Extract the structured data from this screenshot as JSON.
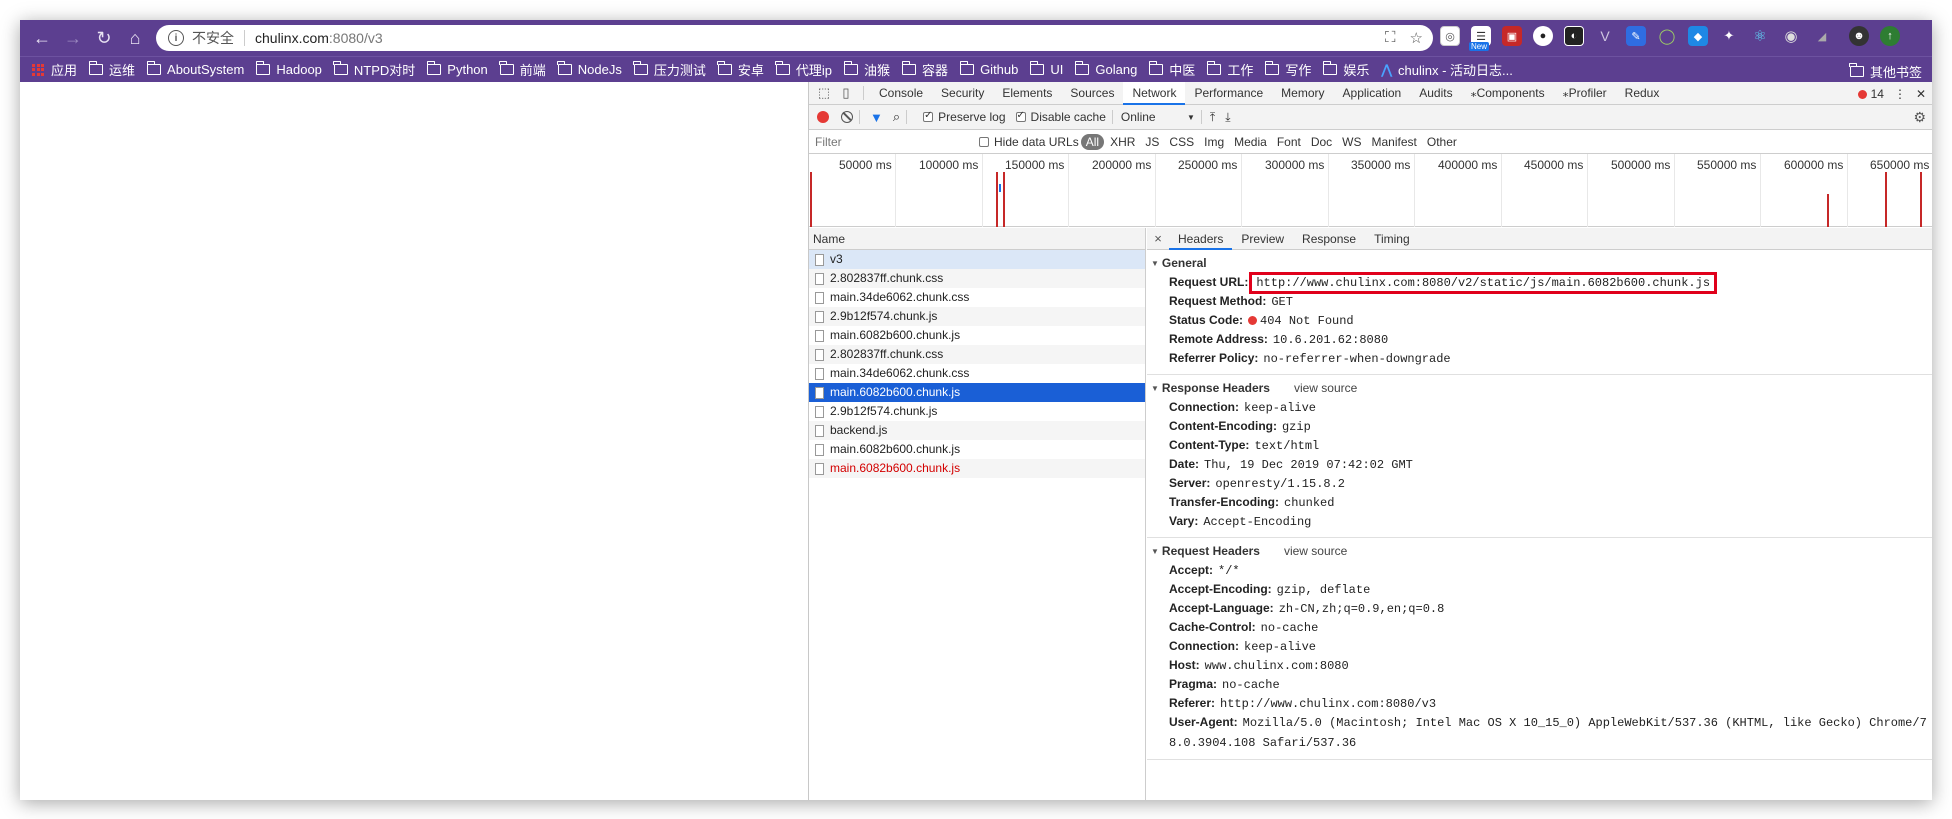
{
  "browser": {
    "nav": {
      "back": "←",
      "forward": "→",
      "reload": "↻",
      "home": "⌂"
    },
    "omnibox": {
      "security": "不安全",
      "url_host": "chulinx.com",
      "url_rest": ":8080/v3"
    },
    "ext_badge": "New"
  },
  "bookmarks": {
    "apps": "应用",
    "items": [
      "运维",
      "AboutSystem",
      "Hadoop",
      "NTPD对时",
      "Python",
      "前端",
      "NodeJs",
      "压力测试",
      "安卓",
      "代理ip",
      "油猴",
      "容器",
      "Github",
      "UI",
      "Golang",
      "中医",
      "工作",
      "写作",
      "娱乐"
    ],
    "special": "chulinx - 活动日志...",
    "other": "其他书签"
  },
  "devtools": {
    "tabs": [
      "Console",
      "Security",
      "Elements",
      "Sources",
      "Network",
      "Performance",
      "Memory",
      "Application",
      "Audits",
      "⁎Components",
      "⁎Profiler",
      "Redux"
    ],
    "active_tab": "Network",
    "error_count": "14",
    "toolbar": {
      "preserve_log": "Preserve log",
      "disable_cache": "Disable cache",
      "throttle": "Online"
    },
    "filter": {
      "placeholder": "Filter",
      "hide_data_urls": "Hide data URLs",
      "types": [
        "All",
        "XHR",
        "JS",
        "CSS",
        "Img",
        "Media",
        "Font",
        "Doc",
        "WS",
        "Manifest",
        "Other"
      ]
    },
    "overview_ticks": [
      "50000 ms",
      "100000 ms",
      "150000 ms",
      "200000 ms",
      "250000 ms",
      "300000 ms",
      "350000 ms",
      "400000 ms",
      "450000 ms",
      "500000 ms",
      "550000 ms",
      "600000 ms",
      "650000 ms"
    ],
    "name_header": "Name",
    "requests": [
      "v3",
      "2.802837ff.chunk.css",
      "main.34de6062.chunk.css",
      "2.9b12f574.chunk.js",
      "main.6082b600.chunk.js",
      "2.802837ff.chunk.css",
      "main.34de6062.chunk.css",
      "main.6082b600.chunk.js",
      "2.9b12f574.chunk.js",
      "backend.js",
      "main.6082b600.chunk.js",
      "main.6082b600.chunk.js"
    ],
    "detail_tabs": [
      "Headers",
      "Preview",
      "Response",
      "Timing"
    ],
    "general": {
      "title": "General",
      "request_url_k": "Request URL:",
      "request_url_v": "http://www.chulinx.com:8080/v2/static/js/main.6082b600.chunk.js",
      "method_k": "Request Method:",
      "method_v": "GET",
      "status_k": "Status Code:",
      "status_v": "404 Not Found",
      "remote_k": "Remote Address:",
      "remote_v": "10.6.201.62:8080",
      "referrer_k": "Referrer Policy:",
      "referrer_v": "no-referrer-when-downgrade"
    },
    "response_headers": {
      "title": "Response Headers",
      "view_source": "view source",
      "rows": [
        {
          "k": "Connection:",
          "v": "keep-alive"
        },
        {
          "k": "Content-Encoding:",
          "v": "gzip"
        },
        {
          "k": "Content-Type:",
          "v": "text/html"
        },
        {
          "k": "Date:",
          "v": "Thu, 19 Dec 2019 07:42:02 GMT"
        },
        {
          "k": "Server:",
          "v": "openresty/1.15.8.2"
        },
        {
          "k": "Transfer-Encoding:",
          "v": "chunked"
        },
        {
          "k": "Vary:",
          "v": "Accept-Encoding"
        }
      ]
    },
    "request_headers": {
      "title": "Request Headers",
      "view_source": "view source",
      "rows": [
        {
          "k": "Accept:",
          "v": "*/*"
        },
        {
          "k": "Accept-Encoding:",
          "v": "gzip, deflate"
        },
        {
          "k": "Accept-Language:",
          "v": "zh-CN,zh;q=0.9,en;q=0.8"
        },
        {
          "k": "Cache-Control:",
          "v": "no-cache"
        },
        {
          "k": "Connection:",
          "v": "keep-alive"
        },
        {
          "k": "Host:",
          "v": "www.chulinx.com:8080"
        },
        {
          "k": "Pragma:",
          "v": "no-cache"
        },
        {
          "k": "Referer:",
          "v": "http://www.chulinx.com:8080/v3"
        },
        {
          "k": "User-Agent:",
          "v": "Mozilla/5.0 (Macintosh; Intel Mac OS X 10_15_0) AppleWebKit/537.36 (KHTML, like Gecko) Chrome/78.0.3904.108 Safari/537.36"
        }
      ]
    }
  },
  "colors": {
    "toolbar": "#5c3f90",
    "accent": "#1a73e8",
    "error": "#e53935",
    "selected_row": "#1a5fd6"
  }
}
